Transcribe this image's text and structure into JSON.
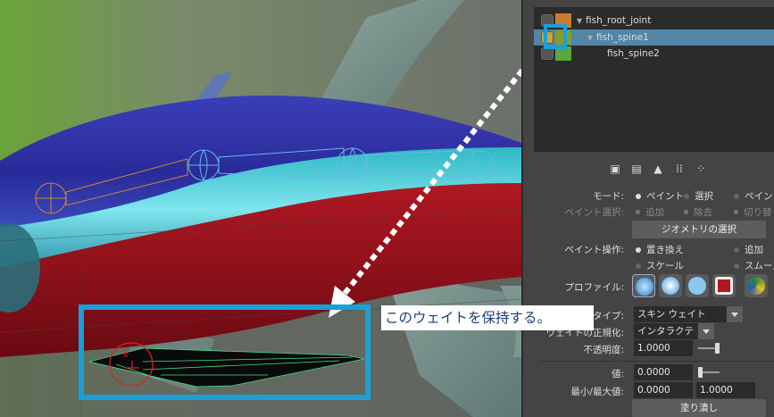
{
  "outliner": {
    "items": [
      {
        "name": "fish_root_joint",
        "color": "#c97b30"
      },
      {
        "name": "fish_spine1",
        "color": "#8a9a2a",
        "selected": true
      },
      {
        "name": "fish_spine2",
        "color": "#5aa83a"
      }
    ]
  },
  "toolstrip": {
    "icons": [
      "copy-weights-icon",
      "paste-weights-icon",
      "weight-hammer-icon",
      "mirror-weights-icon",
      "prune-weights-icon"
    ]
  },
  "settings": {
    "mode_label": "モード:",
    "mode_paint": "ペイント",
    "mode_select": "選択",
    "mode_paint_cut": "ペイント",
    "paint_select_label": "ペイント選択:",
    "paint_select_add": "追加",
    "paint_select_remove": "除去",
    "paint_select_toggle": "切り替",
    "geometry_select_button": "ジオメトリの選択",
    "paint_op_label": "ペイント操作:",
    "op_replace": "置き換え",
    "op_add": "追加",
    "op_scale": "スケール",
    "op_smooth": "スムーズ",
    "profile_label": "プロファイル:",
    "type_label_cut": "タイプ:",
    "type_value": "スキン ウェイト",
    "normalize_label_cut": "ウェイトの正規化:",
    "normalize_value": "インタラクティブ",
    "opacity_label": "不透明度:",
    "opacity_value": "1.0000",
    "opacity_level": 1.0,
    "value_label": "値:",
    "value_value": "0.0000",
    "value_level": 0.0,
    "minmax_label": "最小/最大値:",
    "min_value": "0.0000",
    "max_value": "1.0000",
    "flood_button": "塗り潰し"
  },
  "callout": {
    "text": "このウェイトを保持する。"
  },
  "colors": {
    "highlight": "#18a0d8",
    "selection": "#5285a6",
    "callout_text": "#1c3e7a"
  }
}
